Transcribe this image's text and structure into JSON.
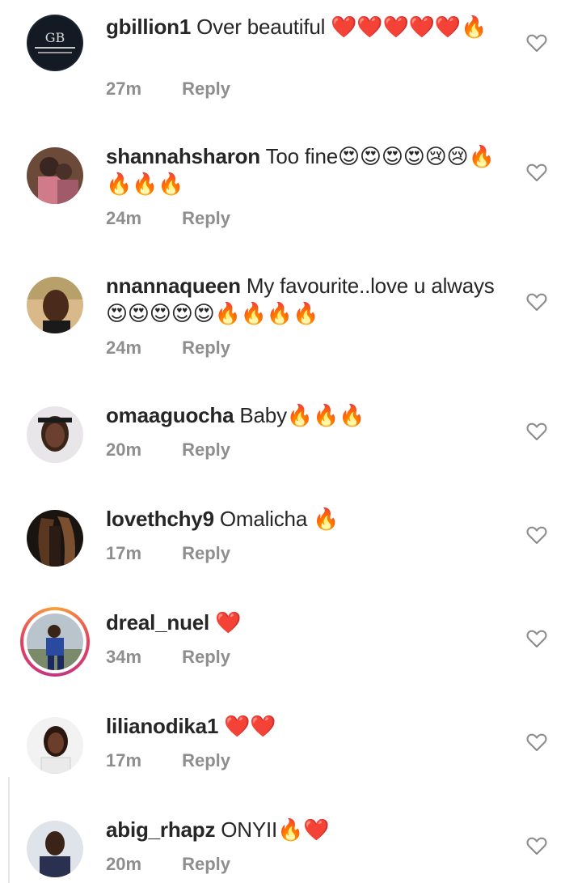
{
  "comments": [
    {
      "username": "gbillion1",
      "text": "Over beautiful ❤️❤️❤️❤️❤️🔥",
      "time": "27m",
      "reply": "Reply",
      "avatar_logo": "GB"
    },
    {
      "username": "shannahsharon",
      "text": "Too fine😍😍😍😍😢😢🔥🔥🔥🔥",
      "time": "24m",
      "reply": "Reply"
    },
    {
      "username": "nnannaqueen",
      "text": "My favourite..love u always😍😍😍😍😍🔥🔥🔥🔥",
      "time": "24m",
      "reply": "Reply"
    },
    {
      "username": "omaaguocha",
      "text": "Baby🔥🔥🔥",
      "time": "20m",
      "reply": "Reply"
    },
    {
      "username": "lovethchy9",
      "text": "Omalicha 🔥",
      "time": "17m",
      "reply": "Reply"
    },
    {
      "username": "dreal_nuel",
      "text": "❤️",
      "time": "34m",
      "reply": "Reply"
    },
    {
      "username": "lilianodika1",
      "text": "❤️❤️",
      "time": "17m",
      "reply": "Reply"
    },
    {
      "username": "abig_rhapz",
      "text": "ONYII🔥❤️",
      "time": "20m",
      "reply": "Reply"
    }
  ]
}
